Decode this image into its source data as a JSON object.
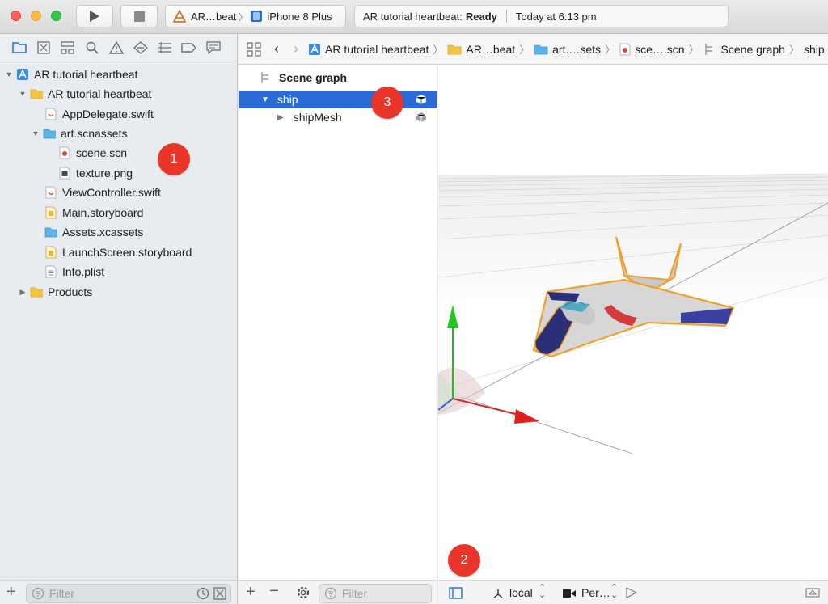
{
  "toolbar": {
    "scheme_app": "AR…beat",
    "scheme_device": "iPhone 8 Plus",
    "activity_project": "AR tutorial heartbeat:",
    "activity_status": "Ready",
    "activity_time": "Today at 6:13 pm"
  },
  "navigator": {
    "tabs": [
      "folder-icon",
      "source-control-icon",
      "hierarchy-icon",
      "search-icon",
      "warning-icon",
      "test-icon",
      "debug-icon",
      "breakpoint-icon",
      "report-icon"
    ],
    "items": [
      {
        "label": "AR tutorial heartbeat",
        "icon": "project-icon",
        "expanded": true
      },
      {
        "label": "AR tutorial heartbeat",
        "icon": "folder-icon",
        "expanded": true
      },
      {
        "label": "AppDelegate.swift",
        "icon": "swift-file-icon"
      },
      {
        "label": "art.scnassets",
        "icon": "blue-folder-icon",
        "expanded": true
      },
      {
        "label": "scene.scn",
        "icon": "scene-file-icon"
      },
      {
        "label": "texture.png",
        "icon": "image-file-icon"
      },
      {
        "label": "ViewController.swift",
        "icon": "swift-file-icon"
      },
      {
        "label": "Main.storyboard",
        "icon": "storyboard-file-icon"
      },
      {
        "label": "Assets.xcassets",
        "icon": "blue-folder-icon"
      },
      {
        "label": "LaunchScreen.storyboard",
        "icon": "storyboard-file-icon"
      },
      {
        "label": "Info.plist",
        "icon": "plist-file-icon"
      },
      {
        "label": "Products",
        "icon": "folder-icon",
        "expanded": false
      }
    ],
    "filter_placeholder": "Filter"
  },
  "jumpbar": {
    "items": [
      "AR tutorial heartbeat",
      "AR…beat",
      "art.…sets",
      "sce….scn",
      "Scene graph",
      "ship"
    ]
  },
  "outline": {
    "header": "Scene graph",
    "nodes": [
      {
        "label": "ship",
        "selected": true,
        "expanded": true
      },
      {
        "label": "shipMesh",
        "selected": false,
        "expanded": false
      }
    ],
    "filter_placeholder": "Filter"
  },
  "viewport": {
    "space_mode": "local",
    "camera_mode": "Per…"
  },
  "badges": [
    "1",
    "2",
    "3"
  ],
  "colors": {
    "selection": "#2a6bd6",
    "badge": "#e9352a",
    "folder": "#f4c542",
    "blue_folder": "#5ab4e8"
  }
}
